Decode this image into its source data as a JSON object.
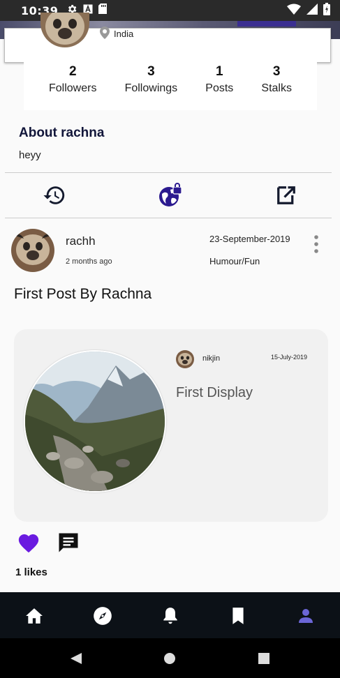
{
  "status_bar": {
    "time": "10:39",
    "left_icons": [
      "settings-icon",
      "text-a-icon",
      "sd-card-icon"
    ],
    "right_icons": [
      "wifi-icon",
      "signal-icon",
      "battery-icon"
    ]
  },
  "profile": {
    "location": "India"
  },
  "stats": [
    {
      "value": "2",
      "label": "Followers"
    },
    {
      "value": "3",
      "label": "Followings"
    },
    {
      "value": "1",
      "label": "Posts"
    },
    {
      "value": "3",
      "label": "Stalks"
    }
  ],
  "about": {
    "title": "About rachna",
    "bio": "heyy"
  },
  "toolbar": {
    "icons": [
      "history-icon",
      "globe-lock-icon",
      "edit-external-icon"
    ]
  },
  "post": {
    "author": "rachh",
    "time_ago": "2 months ago",
    "date": "23-September-2019",
    "category": "Humour/Fun",
    "title": "First Post By Rachna",
    "shared": {
      "user": "nikjin",
      "date": "15-July-2019",
      "title": "First Display"
    },
    "likes": "1 likes"
  },
  "bottom_nav": {
    "items": [
      "home-icon",
      "explore-icon",
      "notifications-icon",
      "bookmark-icon",
      "profile-icon"
    ],
    "active": "profile-icon"
  },
  "colors": {
    "accent": "#6a1be0",
    "nav_bg": "#0c1117",
    "active_nav": "#6b66d6"
  }
}
